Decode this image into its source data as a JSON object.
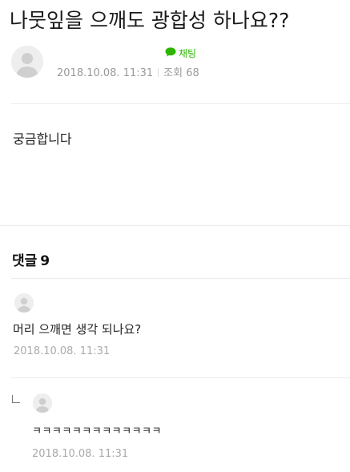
{
  "post": {
    "title": "나뭇잎을 으깨도 광합성 하나요??",
    "chat_label": "채팅",
    "date": "2018.10.08. 11:31",
    "views": "조회 68",
    "body": "궁금합니다"
  },
  "comments": {
    "heading": "댓글",
    "count": "9",
    "items": [
      {
        "text": "머리 으깨면 생각 되나요?",
        "date": "2018.10.08. 11:31"
      },
      {
        "text": "ㅋㅋㅋㅋㅋㅋㅋㅋㅋㅋㅋㅋㅋ",
        "date": "2018.10.08. 11:31"
      }
    ]
  },
  "colors": {
    "accent_green": "#2db400",
    "meta_gray": "#999999",
    "divider": "#ececec"
  },
  "icons": {
    "avatar": "default-profile-icon",
    "chat": "chat-bubble-icon",
    "reply": "reply-indent-icon"
  }
}
